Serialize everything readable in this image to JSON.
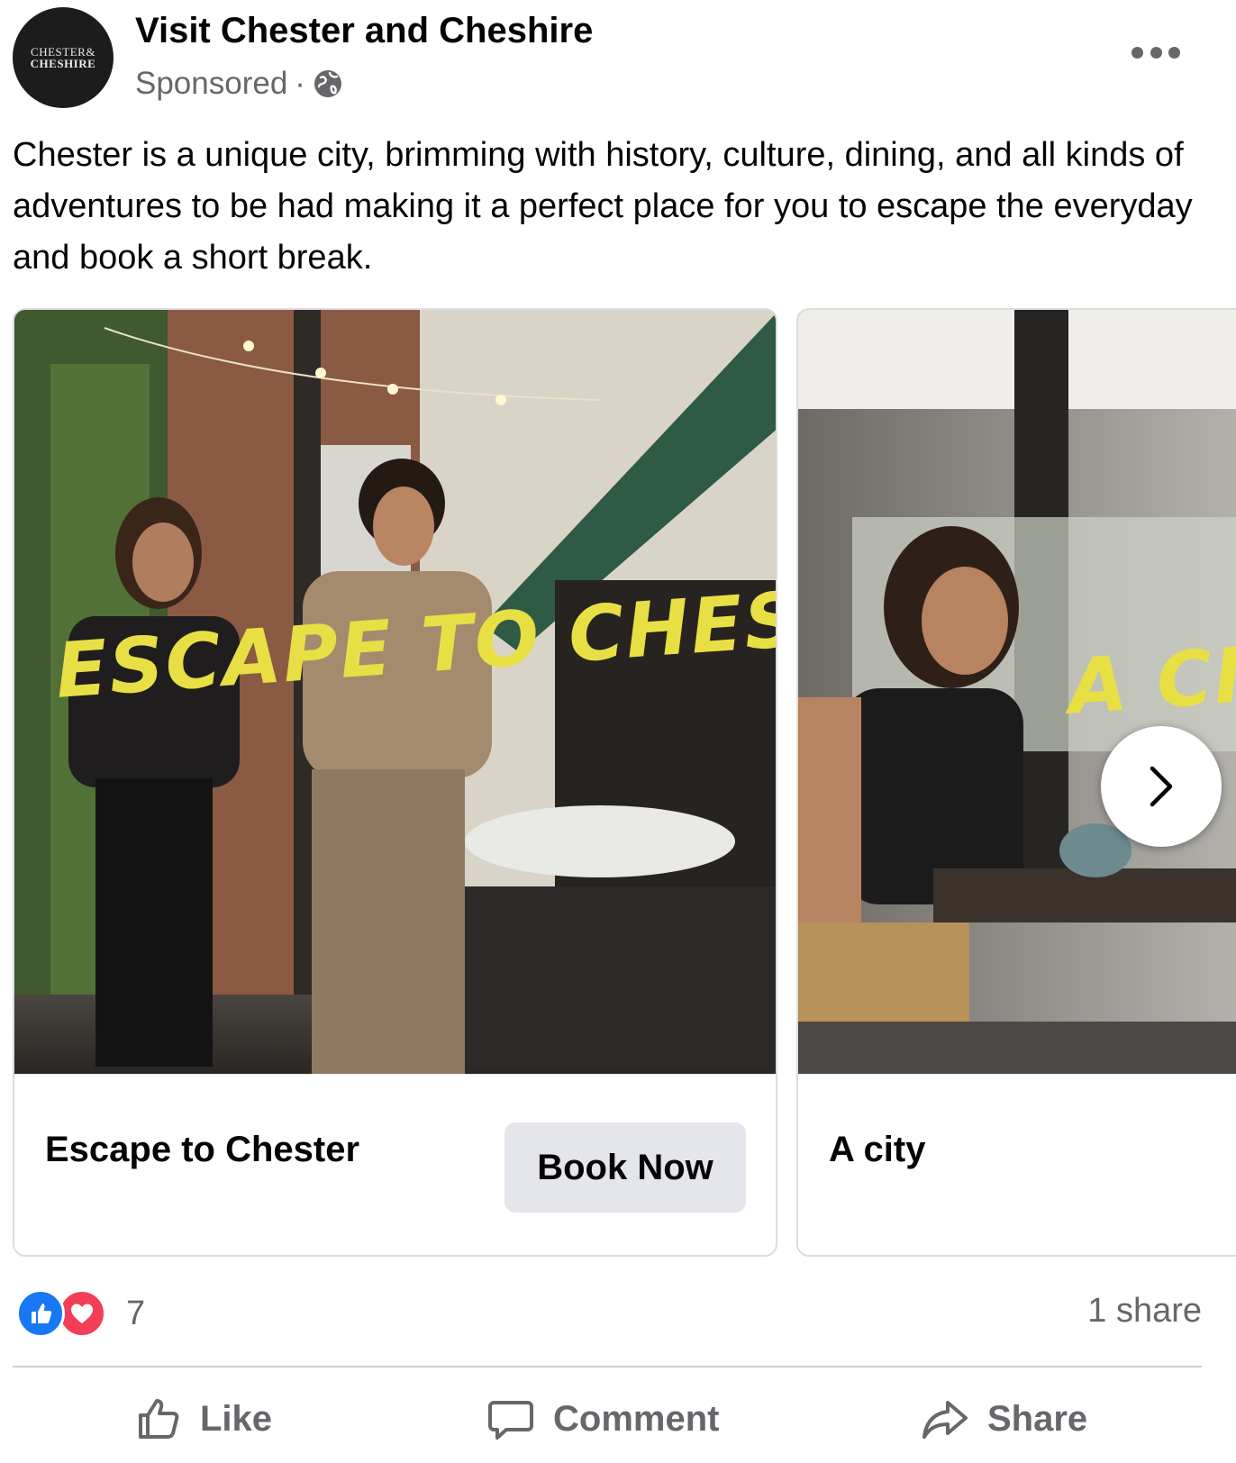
{
  "post": {
    "page_name": "Visit Chester and Cheshire",
    "avatar_text_line1": "CHESTER&",
    "avatar_text_line2": "CHESHIRE",
    "sponsored_label": "Sponsored",
    "separator": "·",
    "message": "Chester is a unique city, brimming with history, culture, dining, and all kinds of adventures to be had making it a perfect place for you to escape the everyday and book a short break."
  },
  "carousel": {
    "cards": [
      {
        "overlay_text": "ESCAPE TO CHESTER",
        "title": "Escape to Chester",
        "cta_label": "Book Now"
      },
      {
        "overlay_text": "A CIT",
        "title": "A city"
      }
    ]
  },
  "engagement": {
    "reaction_count": "7",
    "share_count": "1 share"
  },
  "actions": {
    "like_label": "Like",
    "comment_label": "Comment",
    "share_label": "Share"
  },
  "colors": {
    "text_primary": "#050505",
    "text_secondary": "#65676b",
    "like_blue": "#1877f2",
    "love_red": "#f33e58",
    "overlay_yellow": "#e8df45",
    "button_bg": "#e4e6eb"
  },
  "icons": [
    "globe-icon",
    "more-options-icon",
    "chevron-right-icon",
    "like-reaction-icon",
    "love-reaction-icon",
    "thumbs-up-icon",
    "comment-icon",
    "share-arrow-icon"
  ]
}
